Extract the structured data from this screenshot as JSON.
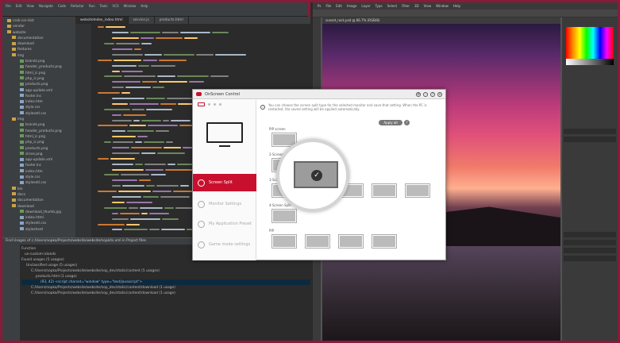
{
  "dialog": {
    "title": "OnScreen Control",
    "description": "You can choose the screen split type for the selected monitor and save that setting. When the PC is restarted, the saved setting will be applied automatically.",
    "apply_label": "Apply all",
    "help_label": "?",
    "info_label": "i",
    "sections": [
      "PIP screen",
      "2-Screen",
      "3-Screen",
      "4-Screen Split",
      "PIP"
    ],
    "menu": [
      {
        "label": "Screen Split",
        "active": true
      },
      {
        "label": "Monitor Settings",
        "active": false
      },
      {
        "label": "My Application Preset",
        "active": false
      },
      {
        "label": "Game mode settings",
        "active": false
      }
    ],
    "window_controls": [
      "settings",
      "minimize",
      "help",
      "close"
    ],
    "accent": "#c8102e"
  },
  "ide": {
    "menu": [
      "File",
      "Edit",
      "View",
      "Navigate",
      "Code",
      "Refactor",
      "Run",
      "Tools",
      "VCS",
      "Window",
      "Help"
    ],
    "tabs": [
      {
        "label": "websiteIndex_index.html",
        "active": true
      },
      {
        "label": "service.js",
        "active": false
      },
      {
        "label": "products.html",
        "active": false
      }
    ],
    "tree": [
      "cssk-cor-dist",
      "vendor",
      "website",
      "documentation",
      "download",
      "features",
      "img",
      "brands.png",
      "header_products.png",
      "html_ic.png",
      "php_ic.png",
      "products.png",
      "app-update.xml",
      "footer.inc",
      "index.htm",
      "style.css",
      "stylesetl.css",
      "img",
      "brands.png",
      "header_products.png",
      "html_ic.png",
      "php_ic.png",
      "products.png",
      "slices.png",
      "app-update.xml",
      "footer.inc",
      "index.htm",
      "style.css",
      "stylesetl.css",
      "bin",
      "docs",
      "documentation",
      "download",
      "download_thumb.jpg",
      "index.html",
      "stylesetl.css",
      "stylesheet"
    ],
    "find_title": "Find Usages of c:/Users/nopka/Projects/website/website/nopkits.xml in Project files",
    "find_rows": [
      "Function",
      "un-custom-islands",
      "Found usages (5 usages)",
      "Unclassified usage (5 usages)",
      "C:/Users/nopka/Projects/website/website/nop_dev/static/content (5 usages)",
      "products.html (1 usage)",
      "(93, 42) <script charset=\"window\" type=\"text/javascript\">",
      "C:/Users/nopka/Projects/website/website/nop_dev/static/content/download (1 usage)",
      "C:/Users/nopka/Projects/website/website/nop_dev/static/content/download (1 usage)"
    ]
  },
  "ps": {
    "menu": [
      "Ps",
      "File",
      "Edit",
      "Image",
      "Layer",
      "Type",
      "Select",
      "Filter",
      "3D",
      "View",
      "Window",
      "Help"
    ],
    "doc_tab": "sunset_rock.psd @ 66.7% (RGB/8)"
  }
}
